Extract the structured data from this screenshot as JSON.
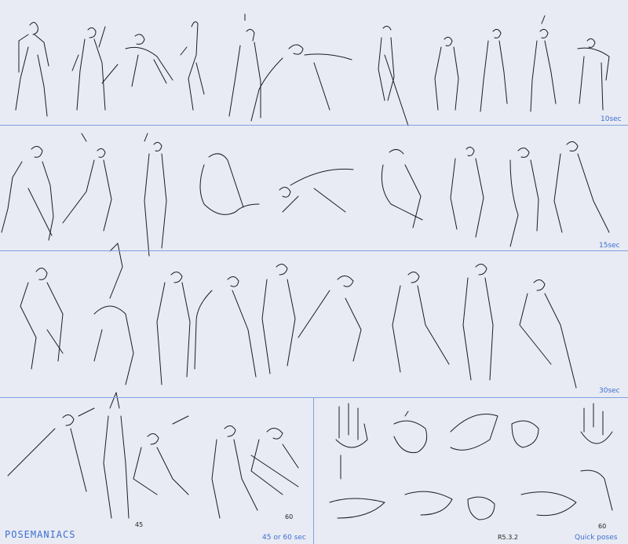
{
  "labels": {
    "row1": "10sec",
    "row2": "15sec",
    "row3": "30sec",
    "row4_time": "45 or 60 sec",
    "row4_note_a": "45",
    "row4_note_b": "60",
    "hands_time": "Quick poses",
    "hands_note_a": "R5.3.2",
    "hands_note_b": "60",
    "brand": "POSEMANIACS"
  },
  "colors": {
    "background": "#e8ebf3",
    "divider": "#7da3e0",
    "label": "#3d6fd1",
    "ink": "#1c1c22"
  }
}
